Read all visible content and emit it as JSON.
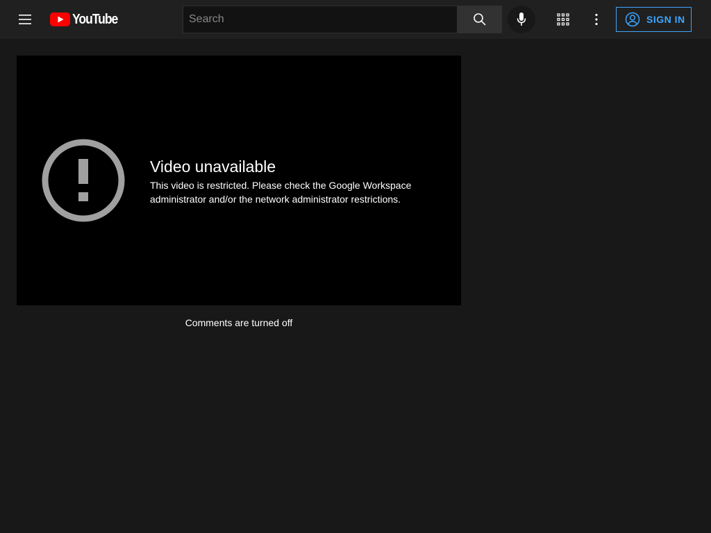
{
  "header": {
    "logo_text": "YouTube",
    "search_placeholder": "Search",
    "search_value": "",
    "signin_label": "SIGN IN",
    "icons": {
      "menu": "hamburger-menu-icon",
      "search": "search-icon",
      "mic": "microphone-icon",
      "apps": "apps-grid-icon",
      "more": "more-vertical-icon",
      "account": "account-circle-icon"
    }
  },
  "player": {
    "error_title": "Video unavailable",
    "error_message": "This video is restricted. Please check the Google Workspace administrator and/or the network administrator restrictions.",
    "icon": "exclamation-circle-icon"
  },
  "comments": {
    "status_text": "Comments are turned off"
  },
  "colors": {
    "background": "#181818",
    "header": "#202020",
    "accent": "#3ea6ff",
    "logo_red": "#ff0000"
  }
}
